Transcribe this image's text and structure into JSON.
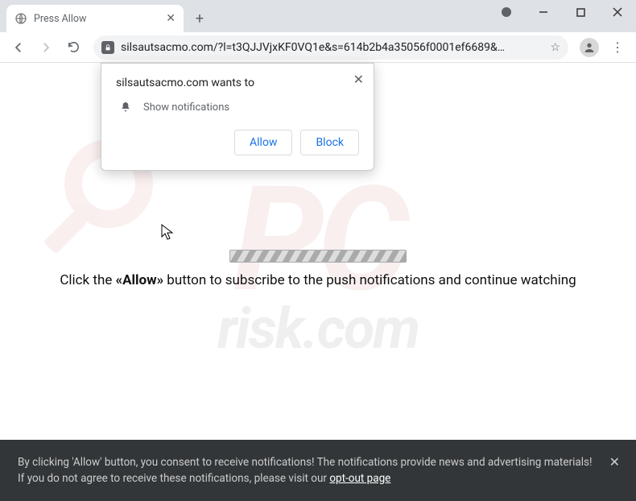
{
  "window": {
    "tab_title": "Press Allow",
    "url_display": "silsautsacmo.com/?l=t3QJJVjxKF0VQ1e&s=614b2b4a35056f0001ef6689&…"
  },
  "permission_popup": {
    "origin_wants_to": "silsautsacmo.com wants to",
    "permission_label": "Show notifications",
    "allow_label": "Allow",
    "block_label": "Block"
  },
  "page": {
    "instruction_pre": "Click the ",
    "instruction_bold": "«Allow»",
    "instruction_post": " button to subscribe to the push notifications and continue watching"
  },
  "consent": {
    "text": "By clicking 'Allow' button, you consent to receive notifications! The notifications provide news and advertising materials! If you do not agree to receive these notifications, please visit our ",
    "link": "opt-out page"
  },
  "watermark": {
    "brand": "PC",
    "suffix": "risk.com"
  }
}
